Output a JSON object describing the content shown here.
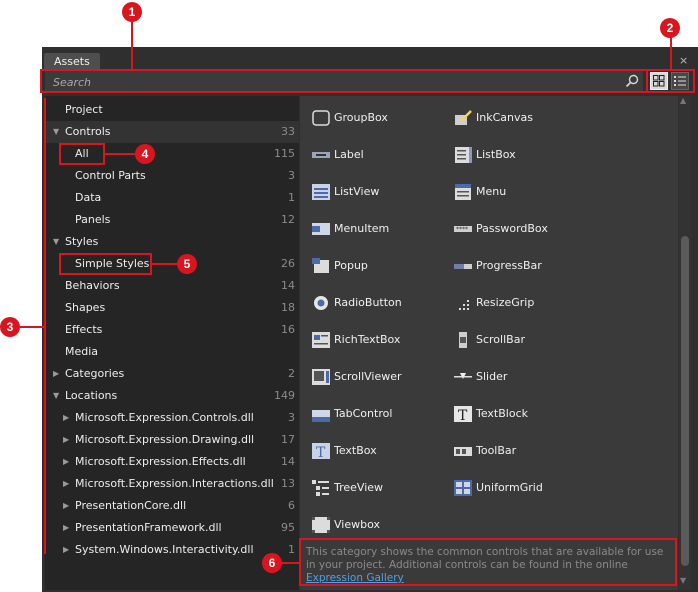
{
  "window": {
    "tab_label": "Assets",
    "close_glyph": "×"
  },
  "search": {
    "placeholder": "Search"
  },
  "view_buttons": [
    {
      "name": "grid-view-icon",
      "active": true
    },
    {
      "name": "list-view-icon",
      "active": false
    }
  ],
  "tree": [
    {
      "label": "Project",
      "count": "",
      "level": 0,
      "arrow": ""
    },
    {
      "label": "Controls",
      "count": "33",
      "level": 0,
      "arrow": "▼"
    },
    {
      "label": "All",
      "count": "115",
      "level": 1,
      "arrow": ""
    },
    {
      "label": "Control Parts",
      "count": "3",
      "level": 1,
      "arrow": ""
    },
    {
      "label": "Data",
      "count": "1",
      "level": 1,
      "arrow": ""
    },
    {
      "label": "Panels",
      "count": "12",
      "level": 1,
      "arrow": ""
    },
    {
      "label": "Styles",
      "count": "",
      "level": 0,
      "arrow": "▼"
    },
    {
      "label": "Simple Styles",
      "count": "26",
      "level": 1,
      "arrow": ""
    },
    {
      "label": "Behaviors",
      "count": "14",
      "level": 0,
      "arrow": ""
    },
    {
      "label": "Shapes",
      "count": "18",
      "level": 0,
      "arrow": ""
    },
    {
      "label": "Effects",
      "count": "16",
      "level": 0,
      "arrow": ""
    },
    {
      "label": "Media",
      "count": "",
      "level": 0,
      "arrow": ""
    },
    {
      "label": "Categories",
      "count": "2",
      "level": 0,
      "arrow": "▶"
    },
    {
      "label": "Locations",
      "count": "149",
      "level": 0,
      "arrow": "▼"
    },
    {
      "label": "Microsoft.Expression.Controls.dll",
      "count": "3",
      "level": 1,
      "arrow": "▶"
    },
    {
      "label": "Microsoft.Expression.Drawing.dll",
      "count": "17",
      "level": 1,
      "arrow": "▶"
    },
    {
      "label": "Microsoft.Expression.Effects.dll",
      "count": "14",
      "level": 1,
      "arrow": "▶"
    },
    {
      "label": "Microsoft.Expression.Interactions.dll",
      "count": "13",
      "level": 1,
      "arrow": "▶"
    },
    {
      "label": "PresentationCore.dll",
      "count": "6",
      "level": 1,
      "arrow": "▶"
    },
    {
      "label": "PresentationFramework.dll",
      "count": "95",
      "level": 1,
      "arrow": "▶"
    },
    {
      "label": "System.Windows.Interactivity.dll",
      "count": "1",
      "level": 1,
      "arrow": "▶"
    }
  ],
  "assets": [
    {
      "label": "GroupBox",
      "icon": "groupbox-icon"
    },
    {
      "label": "InkCanvas",
      "icon": "inkcanvas-icon"
    },
    {
      "label": "Label",
      "icon": "label-icon"
    },
    {
      "label": "ListBox",
      "icon": "listbox-icon"
    },
    {
      "label": "ListView",
      "icon": "listview-icon"
    },
    {
      "label": "Menu",
      "icon": "menu-icon"
    },
    {
      "label": "MenuItem",
      "icon": "menuitem-icon"
    },
    {
      "label": "PasswordBox",
      "icon": "passwordbox-icon"
    },
    {
      "label": "Popup",
      "icon": "popup-icon"
    },
    {
      "label": "ProgressBar",
      "icon": "progressbar-icon"
    },
    {
      "label": "RadioButton",
      "icon": "radiobutton-icon"
    },
    {
      "label": "ResizeGrip",
      "icon": "resizegrip-icon"
    },
    {
      "label": "RichTextBox",
      "icon": "richtextbox-icon"
    },
    {
      "label": "ScrollBar",
      "icon": "scrollbar-icon"
    },
    {
      "label": "ScrollViewer",
      "icon": "scrollviewer-icon"
    },
    {
      "label": "Slider",
      "icon": "slider-icon"
    },
    {
      "label": "TabControl",
      "icon": "tabcontrol-icon"
    },
    {
      "label": "TextBlock",
      "icon": "textblock-icon"
    },
    {
      "label": "TextBox",
      "icon": "textbox-icon"
    },
    {
      "label": "ToolBar",
      "icon": "toolbar-icon"
    },
    {
      "label": "TreeView",
      "icon": "treeview-icon"
    },
    {
      "label": "UniformGrid",
      "icon": "uniformgrid-icon"
    },
    {
      "label": "Viewbox",
      "icon": "viewbox-icon"
    }
  ],
  "description": {
    "text": "This category shows the common controls that are available for use in your project. Additional controls can be found in the online",
    "link": "Expression Gallery"
  },
  "callouts": [
    "1",
    "2",
    "3",
    "4",
    "5",
    "6"
  ],
  "colors": {
    "callout_red": "#d9161f",
    "link_blue": "#4aa3e8",
    "panel_bg": "#2f2f2f"
  }
}
